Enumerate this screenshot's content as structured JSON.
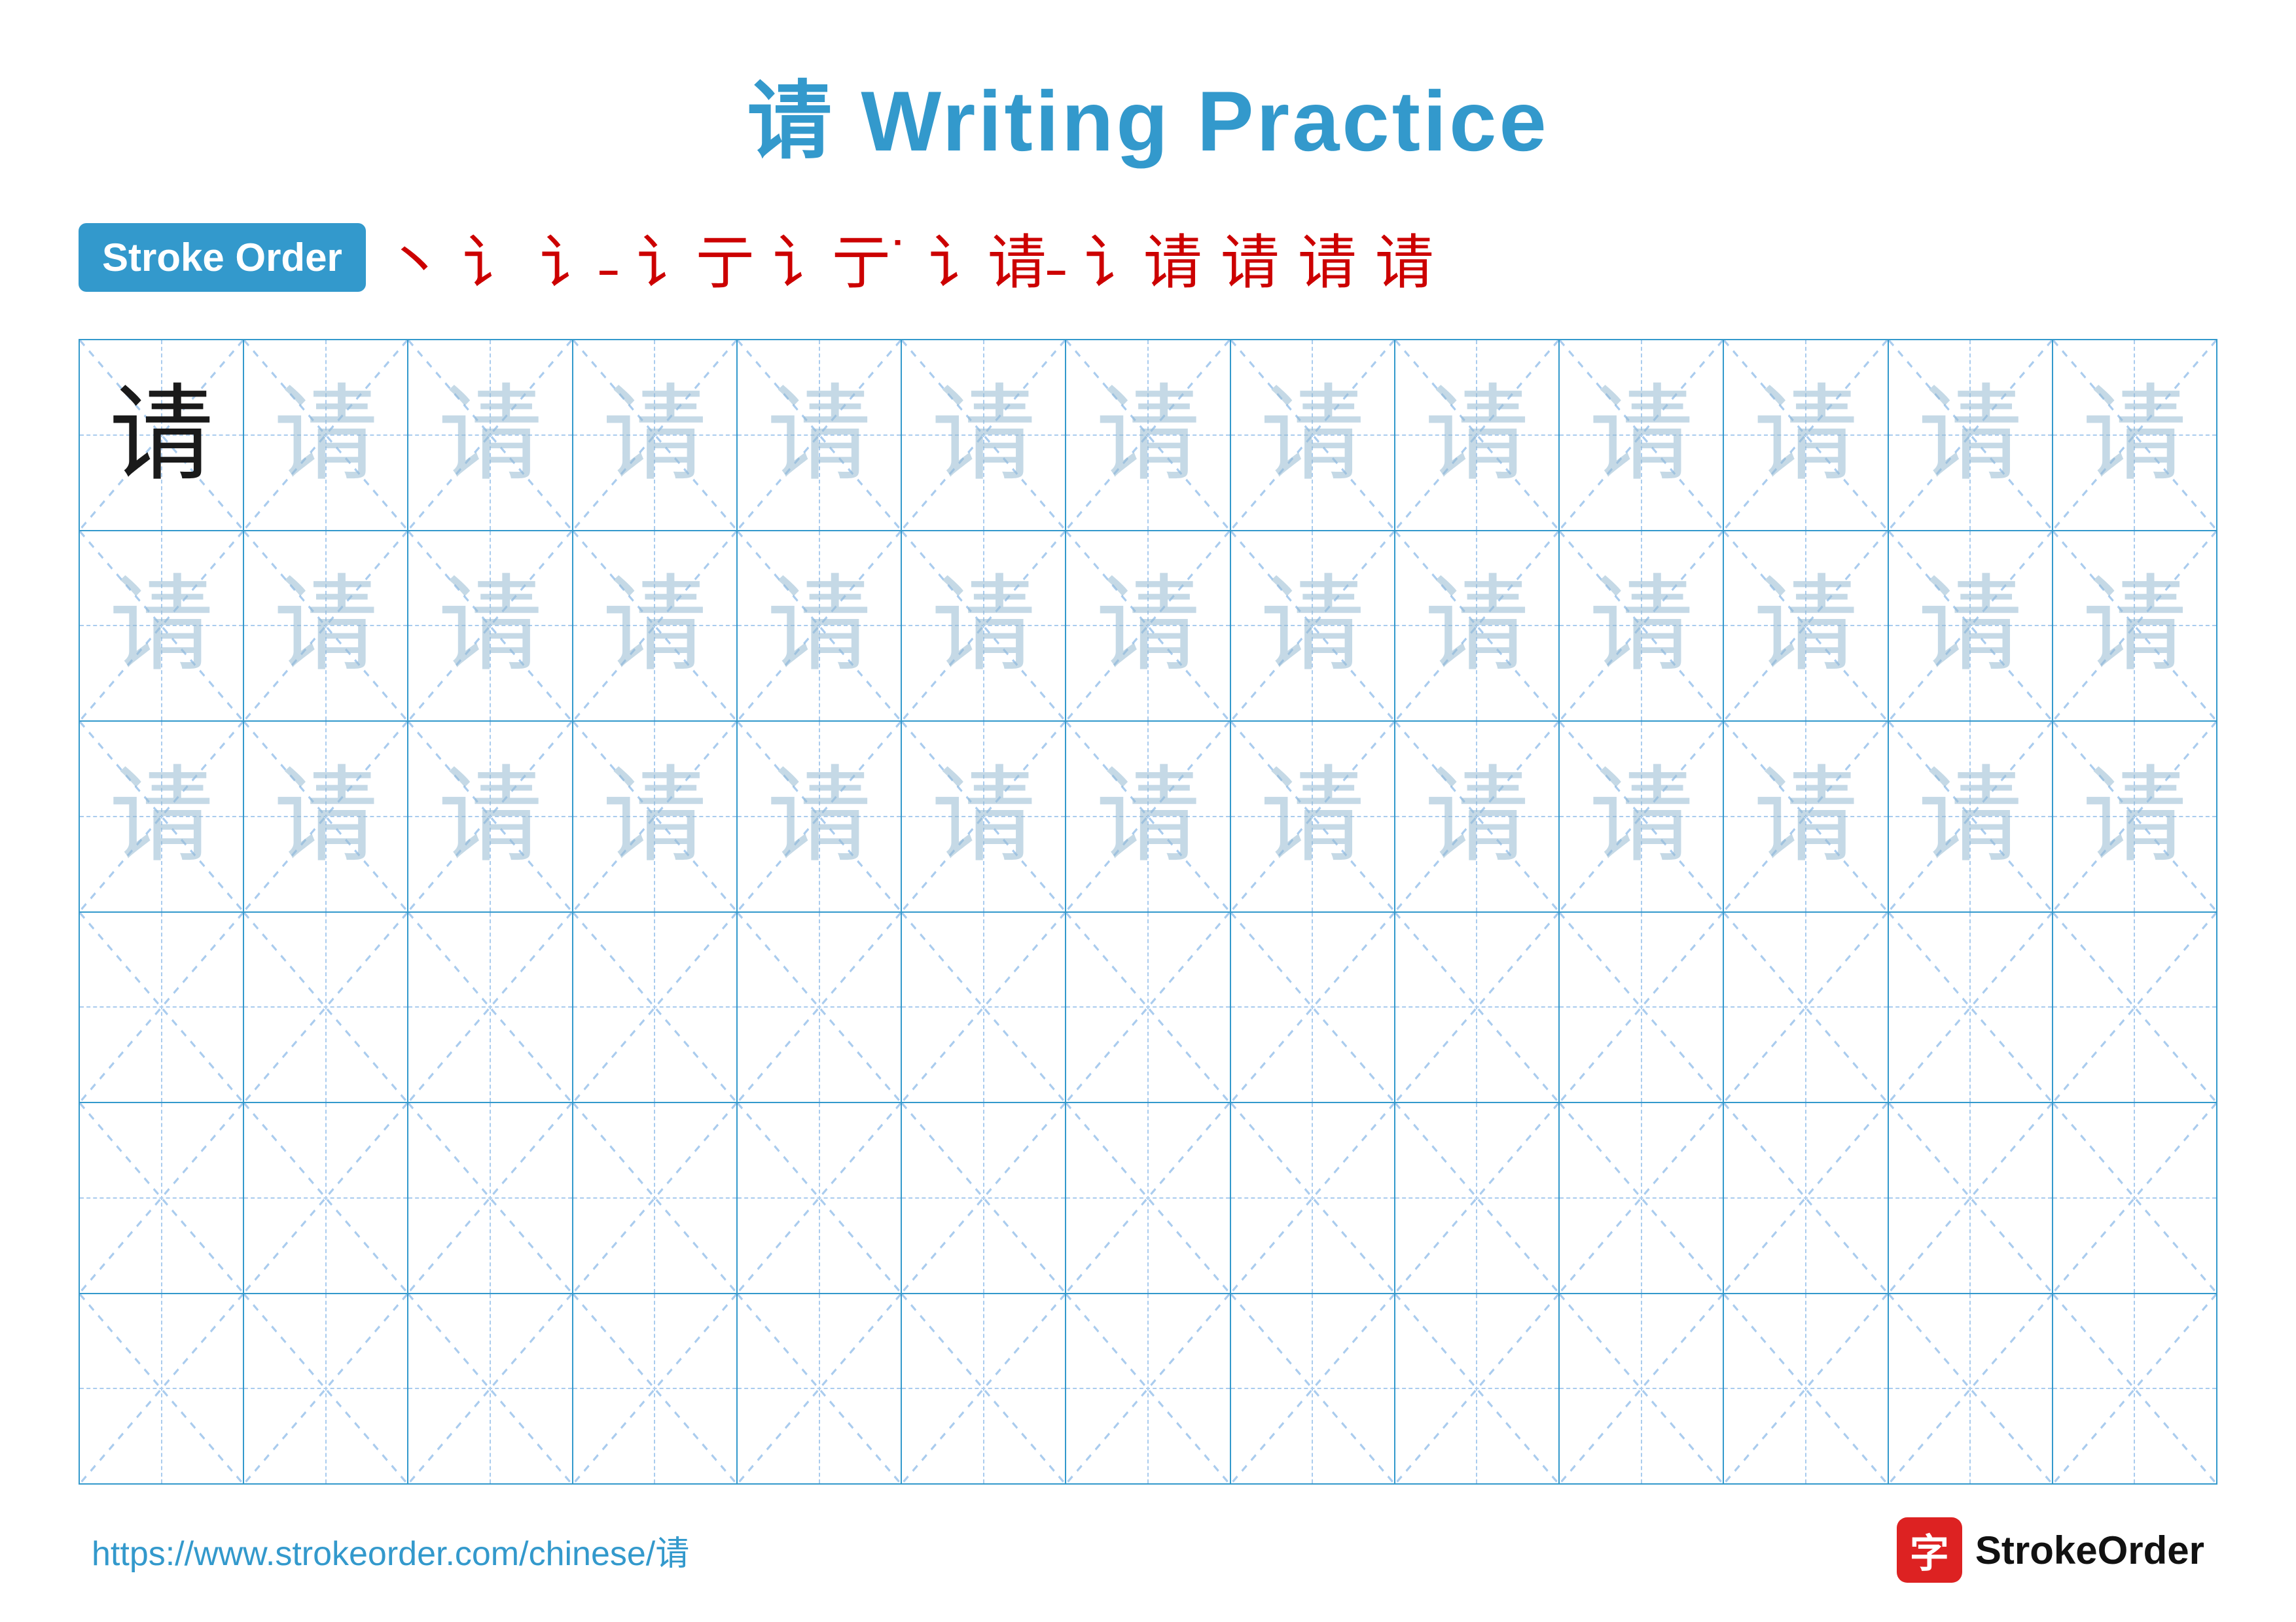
{
  "title": "请 Writing Practice",
  "strokeOrder": {
    "badge": "Stroke Order",
    "sequence": [
      "丶",
      "讠",
      "讠˗",
      "讠亍",
      "讠亍˙",
      "讠请˗",
      "讠请",
      "请",
      "请",
      "请"
    ]
  },
  "grid": {
    "rows": 6,
    "cols": 13,
    "mainChar": "请",
    "rows_data": [
      {
        "type": "example",
        "cells": [
          {
            "char": "请",
            "style": "dark"
          },
          {
            "char": "请",
            "style": "light"
          },
          {
            "char": "请",
            "style": "light"
          },
          {
            "char": "请",
            "style": "light"
          },
          {
            "char": "请",
            "style": "light"
          },
          {
            "char": "请",
            "style": "light"
          },
          {
            "char": "请",
            "style": "light"
          },
          {
            "char": "请",
            "style": "light"
          },
          {
            "char": "请",
            "style": "light"
          },
          {
            "char": "请",
            "style": "light"
          },
          {
            "char": "请",
            "style": "light"
          },
          {
            "char": "请",
            "style": "light"
          },
          {
            "char": "请",
            "style": "light"
          }
        ]
      },
      {
        "type": "practice",
        "cells": [
          {
            "char": "请",
            "style": "light"
          },
          {
            "char": "请",
            "style": "light"
          },
          {
            "char": "请",
            "style": "light"
          },
          {
            "char": "请",
            "style": "light"
          },
          {
            "char": "请",
            "style": "light"
          },
          {
            "char": "请",
            "style": "light"
          },
          {
            "char": "请",
            "style": "light"
          },
          {
            "char": "请",
            "style": "light"
          },
          {
            "char": "请",
            "style": "light"
          },
          {
            "char": "请",
            "style": "light"
          },
          {
            "char": "请",
            "style": "light"
          },
          {
            "char": "请",
            "style": "light"
          },
          {
            "char": "请",
            "style": "light"
          }
        ]
      },
      {
        "type": "practice",
        "cells": [
          {
            "char": "请",
            "style": "light"
          },
          {
            "char": "请",
            "style": "light"
          },
          {
            "char": "请",
            "style": "light"
          },
          {
            "char": "请",
            "style": "light"
          },
          {
            "char": "请",
            "style": "light"
          },
          {
            "char": "请",
            "style": "light"
          },
          {
            "char": "请",
            "style": "light"
          },
          {
            "char": "请",
            "style": "light"
          },
          {
            "char": "请",
            "style": "light"
          },
          {
            "char": "请",
            "style": "light"
          },
          {
            "char": "请",
            "style": "light"
          },
          {
            "char": "请",
            "style": "light"
          },
          {
            "char": "请",
            "style": "light"
          }
        ]
      },
      {
        "type": "empty",
        "cells": [
          {
            "char": "",
            "style": "empty"
          },
          {
            "char": "",
            "style": "empty"
          },
          {
            "char": "",
            "style": "empty"
          },
          {
            "char": "",
            "style": "empty"
          },
          {
            "char": "",
            "style": "empty"
          },
          {
            "char": "",
            "style": "empty"
          },
          {
            "char": "",
            "style": "empty"
          },
          {
            "char": "",
            "style": "empty"
          },
          {
            "char": "",
            "style": "empty"
          },
          {
            "char": "",
            "style": "empty"
          },
          {
            "char": "",
            "style": "empty"
          },
          {
            "char": "",
            "style": "empty"
          },
          {
            "char": "",
            "style": "empty"
          }
        ]
      },
      {
        "type": "empty",
        "cells": [
          {
            "char": "",
            "style": "empty"
          },
          {
            "char": "",
            "style": "empty"
          },
          {
            "char": "",
            "style": "empty"
          },
          {
            "char": "",
            "style": "empty"
          },
          {
            "char": "",
            "style": "empty"
          },
          {
            "char": "",
            "style": "empty"
          },
          {
            "char": "",
            "style": "empty"
          },
          {
            "char": "",
            "style": "empty"
          },
          {
            "char": "",
            "style": "empty"
          },
          {
            "char": "",
            "style": "empty"
          },
          {
            "char": "",
            "style": "empty"
          },
          {
            "char": "",
            "style": "empty"
          },
          {
            "char": "",
            "style": "empty"
          }
        ]
      },
      {
        "type": "empty",
        "cells": [
          {
            "char": "",
            "style": "empty"
          },
          {
            "char": "",
            "style": "empty"
          },
          {
            "char": "",
            "style": "empty"
          },
          {
            "char": "",
            "style": "empty"
          },
          {
            "char": "",
            "style": "empty"
          },
          {
            "char": "",
            "style": "empty"
          },
          {
            "char": "",
            "style": "empty"
          },
          {
            "char": "",
            "style": "empty"
          },
          {
            "char": "",
            "style": "empty"
          },
          {
            "char": "",
            "style": "empty"
          },
          {
            "char": "",
            "style": "empty"
          },
          {
            "char": "",
            "style": "empty"
          },
          {
            "char": "",
            "style": "empty"
          }
        ]
      }
    ]
  },
  "footer": {
    "url": "https://www.strokeorder.com/chinese/请",
    "logo_text": "StrokeOrder",
    "logo_char": "字"
  }
}
